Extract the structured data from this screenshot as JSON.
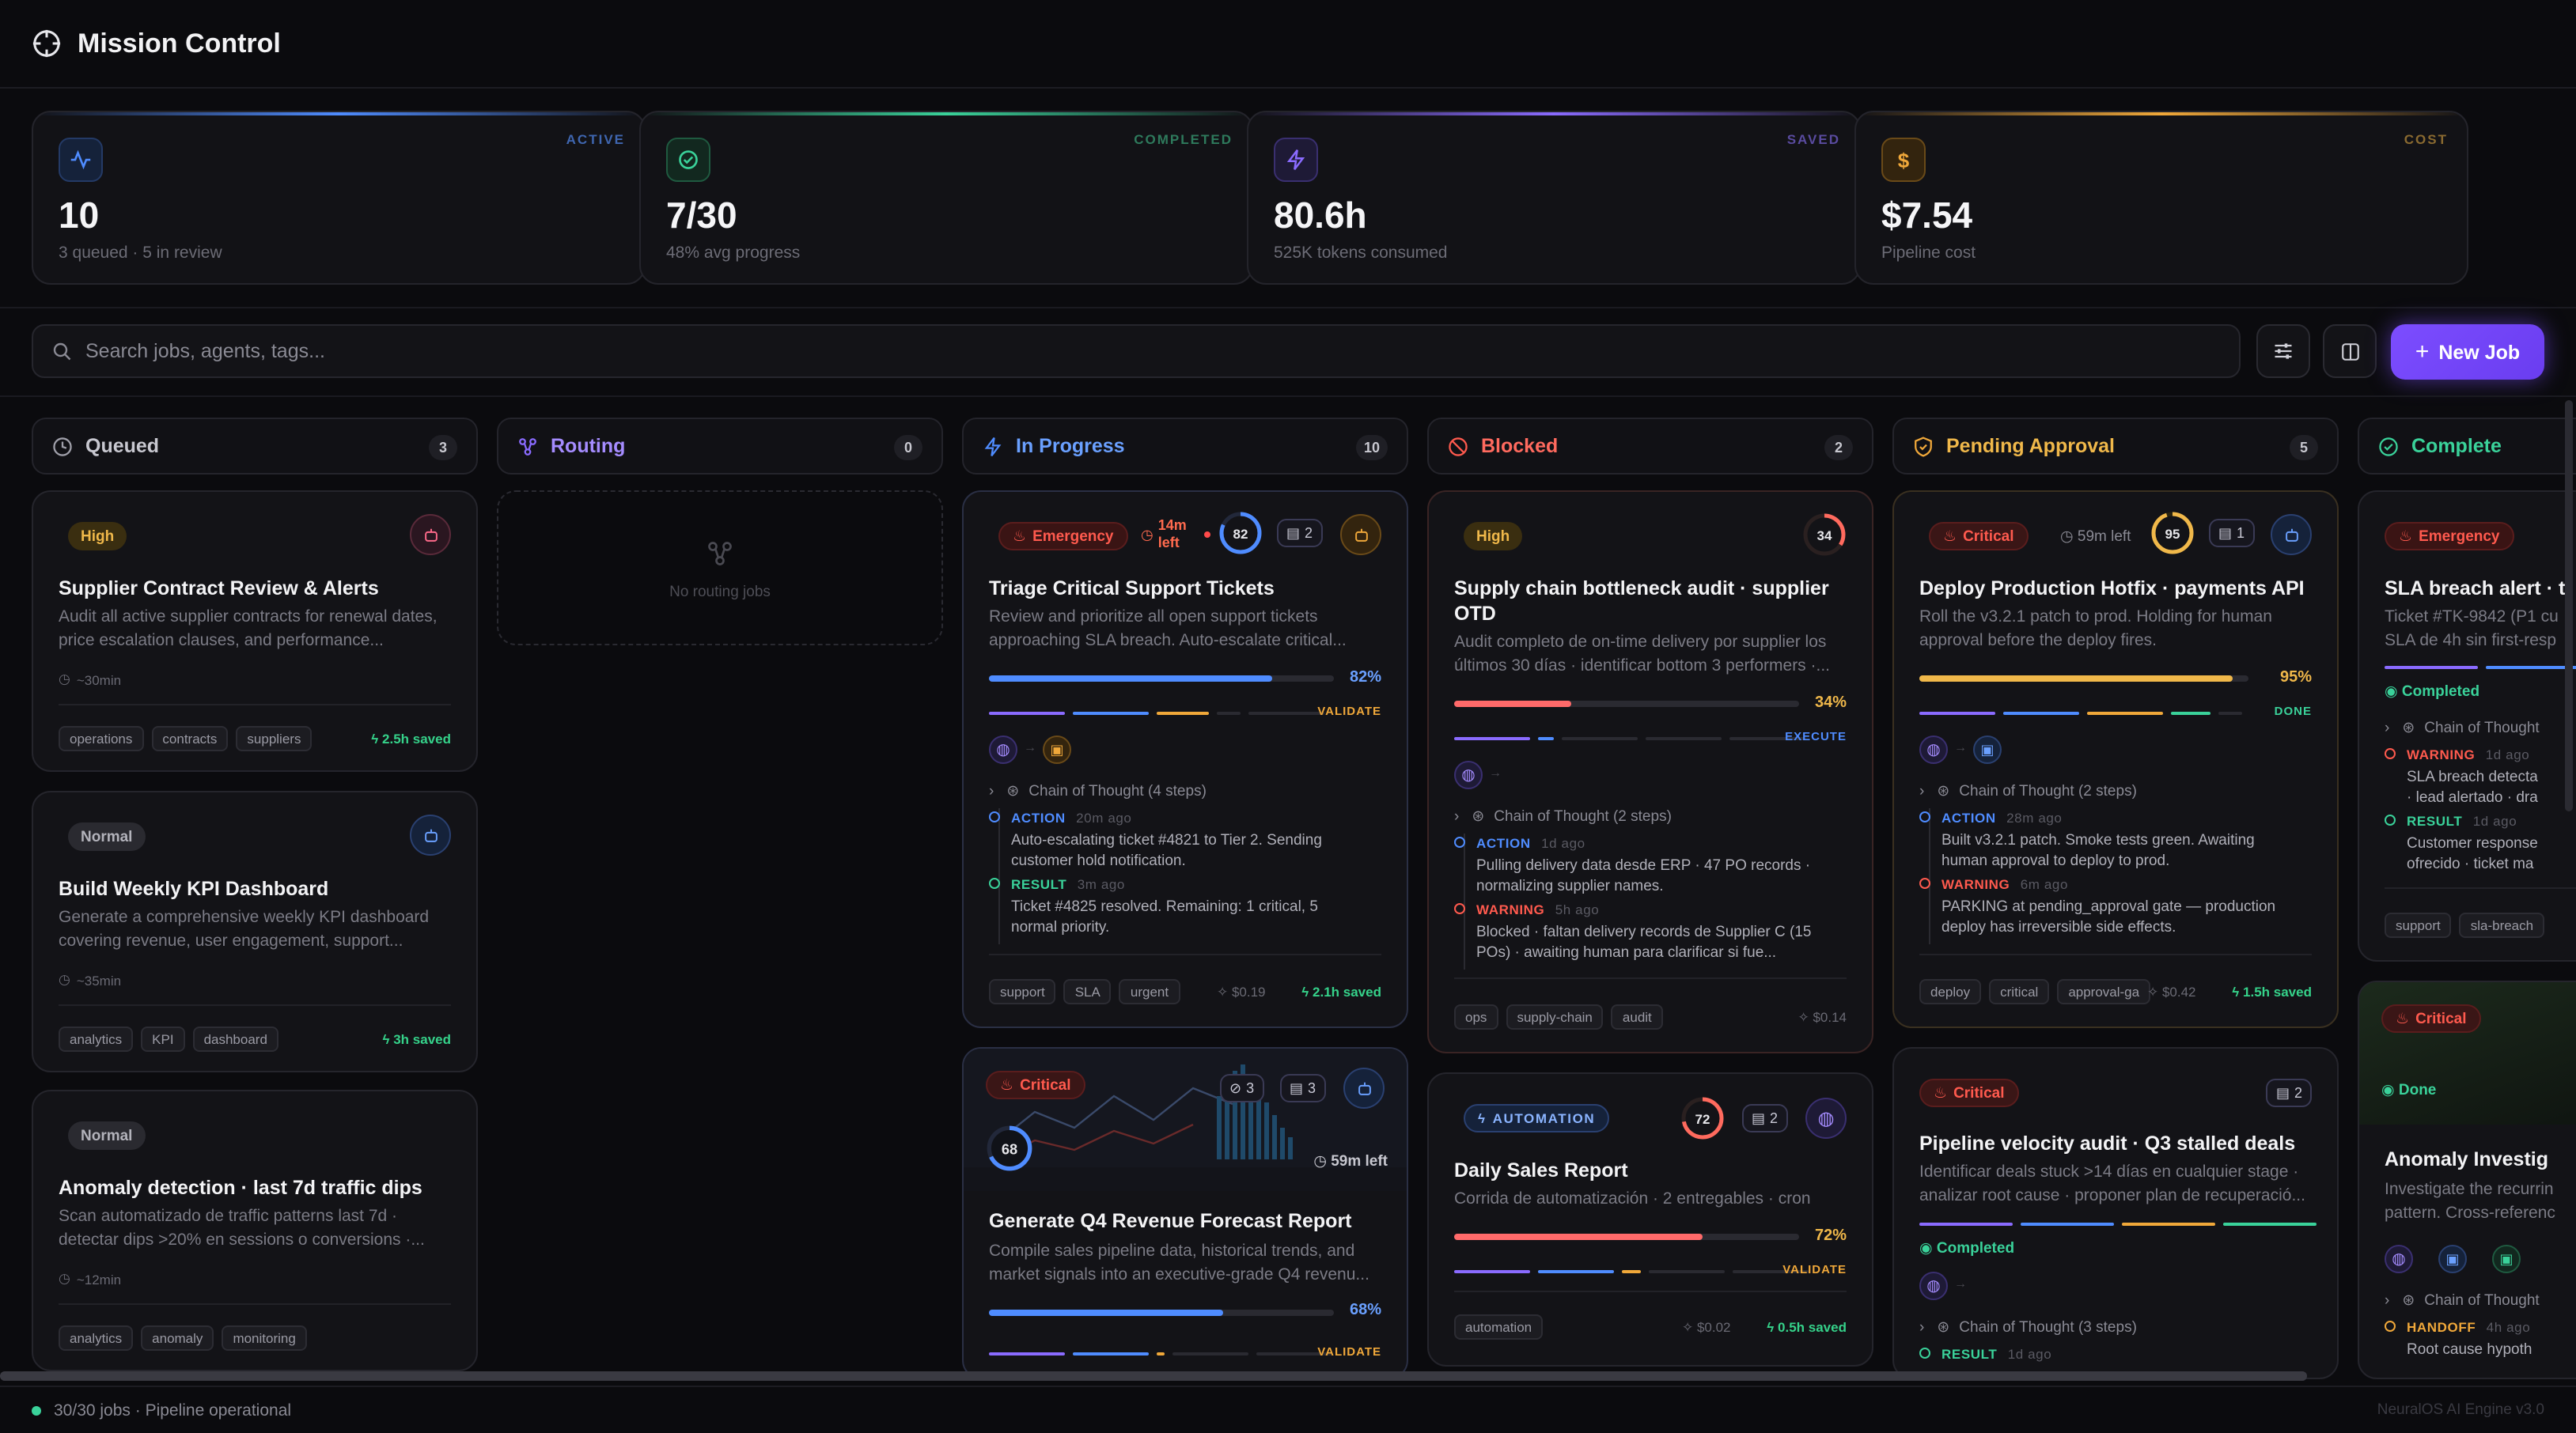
{
  "app": {
    "title": "Mission Control"
  },
  "stats": [
    {
      "tag": "ACTIVE",
      "value": "10",
      "sub": "3 queued · 5 in review",
      "color": "#4f8cff"
    },
    {
      "tag": "COMPLETED",
      "value": "7/30",
      "sub": "48% avg progress",
      "color": "#3ad29a"
    },
    {
      "tag": "SAVED",
      "value": "80.6h",
      "sub": "525K tokens consumed",
      "color": "#8a6bff"
    },
    {
      "tag": "COST",
      "value": "$7.54",
      "sub": "Pipeline cost",
      "color": "#f0a83a"
    }
  ],
  "search": {
    "placeholder": "Search jobs, agents, tags..."
  },
  "new_job_label": "New Job",
  "columns": [
    {
      "name": "Queued",
      "count": "3"
    },
    {
      "name": "Routing",
      "count": "0"
    },
    {
      "name": "In Progress",
      "count": "10"
    },
    {
      "name": "Blocked",
      "count": "2"
    },
    {
      "name": "Pending Approval",
      "count": "5"
    },
    {
      "name": "Complete",
      "count": ""
    }
  ],
  "queued": [
    {
      "priority": "High",
      "title": "Supplier Contract Review & Alerts",
      "desc1": "Audit all active supplier contracts for renewal dates,",
      "desc2": "price escalation clauses, and performance...",
      "eta": "~30min",
      "tags": [
        "operations",
        "contracts",
        "suppliers"
      ],
      "saved": "2.5h saved"
    },
    {
      "priority": "Normal",
      "title": "Build Weekly KPI Dashboard",
      "desc1": "Generate a comprehensive weekly KPI dashboard",
      "desc2": "covering revenue, user engagement, support...",
      "eta": "~35min",
      "tags": [
        "analytics",
        "KPI",
        "dashboard"
      ],
      "saved": "3h saved"
    },
    {
      "priority": "Normal",
      "title": "Anomaly detection · last 7d traffic dips",
      "desc1": "Scan automatizado de traffic patterns last 7d ·",
      "desc2": "detectar dips >20% en sessions o conversions ·...",
      "eta": "~12min",
      "tags": [
        "analytics",
        "anomaly",
        "monitoring"
      ],
      "saved": ""
    }
  ],
  "routing_empty": "No routing jobs",
  "inprogress": [
    {
      "priority": "Emergency",
      "time_left1": "14m",
      "time_left2": "left",
      "score": "82",
      "docs": "2",
      "title": "Triage Critical Support Tickets",
      "desc1": "Review and prioritize all open support tickets",
      "desc2": "approaching SLA breach. Auto-escalate critical...",
      "progress": 82,
      "pct": "82%",
      "stage": "VALIDATE",
      "cot": "Chain of Thought (4 steps)",
      "log": [
        {
          "label": "ACTION",
          "time": "20m ago",
          "l1": "Auto-escalating ticket #4821 to Tier 2. Sending",
          "l2": "customer hold notification."
        },
        {
          "label": "RESULT",
          "time": "3m ago",
          "l1": "Ticket #4825 resolved. Remaining: 1 critical, 5",
          "l2": "normal priority."
        }
      ],
      "tags": [
        "support",
        "SLA",
        "urgent"
      ],
      "cost": "$0.19",
      "saved": "2.1h saved"
    },
    {
      "priority": "Critical",
      "score": "68",
      "links": "3",
      "docs": "3",
      "time_left": "59m left",
      "title": "Generate Q4 Revenue Forecast Report",
      "desc1": "Compile sales pipeline data, historical trends, and",
      "desc2": "market signals into an executive-grade Q4 revenu...",
      "progress": 68,
      "pct": "68%",
      "stage": "VALIDATE"
    }
  ],
  "blocked": [
    {
      "priority": "High",
      "score": "34",
      "title1": "Supply chain bottleneck audit · supplier",
      "title2": "OTD",
      "desc1": "Audit completo de on-time delivery por supplier los",
      "desc2": "últimos 30 días · identificar bottom 3 performers ·...",
      "progress": 34,
      "pct": "34%",
      "stage": "EXECUTE",
      "cot": "Chain of Thought (2 steps)",
      "log": [
        {
          "label": "ACTION",
          "time": "1d ago",
          "l1": "Pulling delivery data desde ERP · 47 PO records ·",
          "l2": "normalizing supplier names."
        },
        {
          "label": "WARNING",
          "time": "5h ago",
          "l1": "Blocked · faltan delivery records de Supplier C (15",
          "l2": "POs) · awaiting human para clarificar si fue..."
        }
      ],
      "tags": [
        "ops",
        "supply-chain",
        "audit"
      ],
      "cost": "$0.14"
    },
    {
      "badge": "AUTOMATION",
      "score": "72",
      "docs": "2",
      "title": "Daily Sales Report",
      "desc1": "Corrida de automatización · 2 entregables · cron",
      "progress": 72,
      "pct": "72%",
      "stage": "VALIDATE",
      "tags": [
        "automation"
      ],
      "cost": "$0.02",
      "saved": "0.5h saved"
    }
  ],
  "pending": [
    {
      "priority": "Critical",
      "time_left": "59m left",
      "score": "95",
      "docs": "1",
      "title": "Deploy Production Hotfix · payments API",
      "desc1": "Roll the v3.2.1 patch to prod. Holding for human",
      "desc2": "approval before the deploy fires.",
      "progress": 95,
      "pct": "95%",
      "stage": "DONE",
      "cot": "Chain of Thought (2 steps)",
      "log": [
        {
          "label": "ACTION",
          "time": "28m ago",
          "l1": "Built v3.2.1 patch. Smoke tests green. Awaiting",
          "l2": "human approval to deploy to prod."
        },
        {
          "label": "WARNING",
          "time": "6m ago",
          "l1": "PARKING at pending_approval gate — production",
          "l2": "deploy has irreversible side effects."
        }
      ],
      "tags": [
        "deploy",
        "critical",
        "approval-ga"
      ],
      "cost": "$0.42",
      "saved": "1.5h saved"
    },
    {
      "priority": "Critical",
      "docs": "2",
      "title": "Pipeline velocity audit · Q3 stalled deals",
      "desc1": "Identificar deals stuck >14 días en cualquier stage ·",
      "desc2": "analizar root cause · proponer plan de recuperació...",
      "status": "Completed",
      "cot": "Chain of Thought (3 steps)",
      "log_label": "RESULT",
      "log_time": "1d ago"
    }
  ],
  "complete": [
    {
      "priority": "Emergency",
      "title": "SLA breach alert · t",
      "desc1": "Ticket #TK-9842 (P1 cu",
      "desc2": "SLA de 4h sin first-resp",
      "status": "Completed",
      "cot": "Chain of Thought",
      "log": [
        {
          "label": "WARNING",
          "time": "1d ago",
          "l1": "SLA breach detecta",
          "l2": "· lead alertado · dra"
        },
        {
          "label": "RESULT",
          "time": "1d ago",
          "l1": "Customer response",
          "l2": "ofrecido · ticket ma"
        }
      ],
      "tags": [
        "support",
        "sla-breach"
      ]
    },
    {
      "priority": "Critical",
      "status": "Done",
      "title": "Anomaly Investig",
      "desc1": "Investigate the recurrin",
      "desc2": "pattern. Cross-referenc",
      "cot": "Chain of Thought",
      "log_label": "HANDOFF",
      "log_time": "4h ago",
      "log_text": "Root cause hypoth"
    }
  ],
  "footer": {
    "status": "30/30 jobs · Pipeline operational",
    "version": "NeuralOS AI Engine v3.0"
  }
}
